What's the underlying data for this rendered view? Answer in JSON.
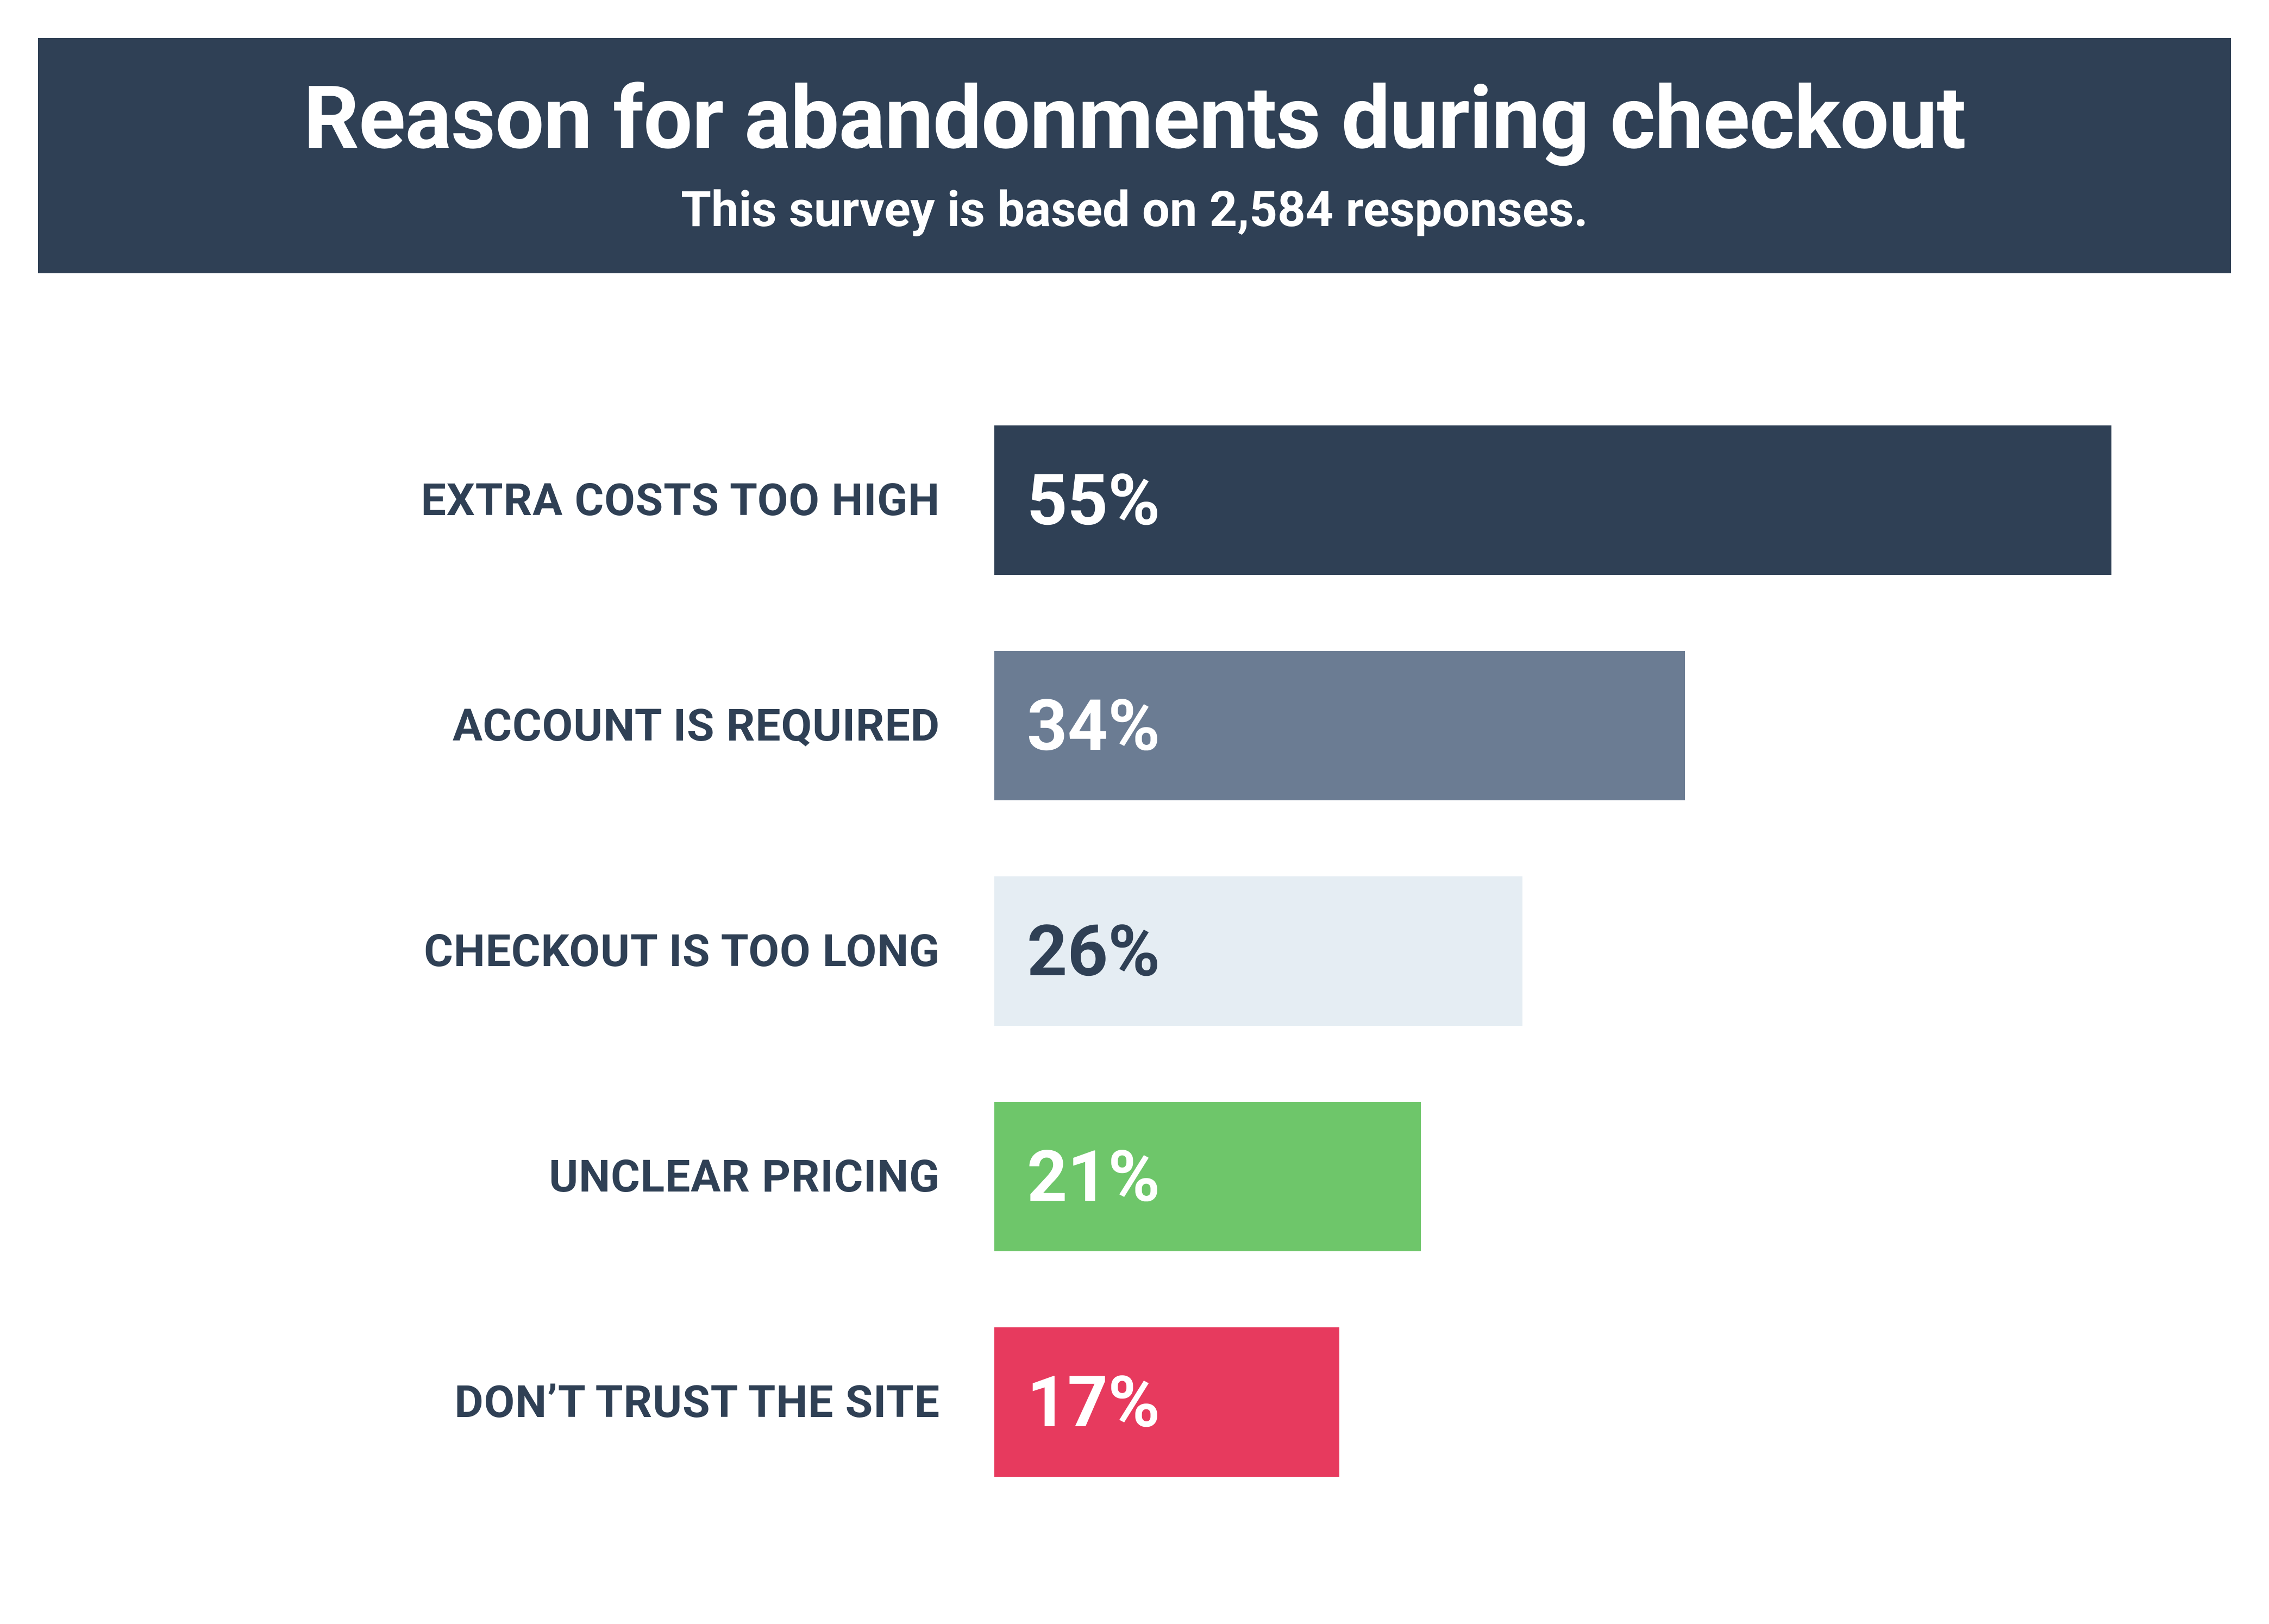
{
  "header": {
    "title": "Reason for abandonments during checkout",
    "subtitle": "This survey is based on 2,584 responses."
  },
  "chart_data": {
    "type": "bar",
    "orientation": "horizontal",
    "categories": [
      "EXTRA COSTS TOO HIGH",
      "ACCOUNT IS REQUIRED",
      "CHECKOUT IS TOO LONG",
      "UNCLEAR PRICING",
      "DON’T TRUST THE SITE"
    ],
    "values": [
      55,
      34,
      26,
      21,
      17
    ],
    "value_labels": [
      "55%",
      "34%",
      "26%",
      "21%",
      "17%"
    ],
    "xlim": [
      0,
      55
    ],
    "xlabel": "",
    "ylabel": "",
    "title": "Reason for abandonments during checkout",
    "bar_colors": [
      "#2f4055",
      "#6b7c93",
      "#e5edf3",
      "#6ec66a",
      "#e73a5e"
    ],
    "label_colors": [
      "#ffffff",
      "#ffffff",
      "#2f4055",
      "#ffffff",
      "#ffffff"
    ]
  }
}
